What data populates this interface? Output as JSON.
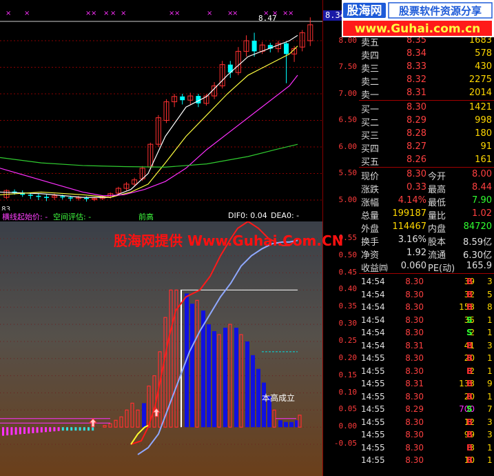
{
  "banner": {
    "logo_text": "股海网",
    "slogan": "股票软件资源分享",
    "url": "www.Guhai.com.cn"
  },
  "main_chart": {
    "price_tag": "8.34",
    "high_label": "8.47",
    "low_label": "83",
    "axis_labels": [
      "8.00",
      "7.50",
      "7.00",
      "6.50",
      "6.00",
      "5.50",
      "5.00"
    ]
  },
  "indicator": {
    "strip_items": [
      {
        "text": "横线起始价: -",
        "color": "#ff40ff"
      },
      {
        "text": "空间评估: -",
        "color": "#40ff40"
      },
      {
        "text": "前高",
        "color": "#40ff40"
      },
      {
        "text": "DIF0: 0.04",
        "color": "#ffffff"
      },
      {
        "text": "DEA0: -",
        "color": "#ffffff"
      }
    ],
    "watermark": "股海网提供 Www.Guhai.Com.CN",
    "annotation": "本高成立",
    "axis_labels": [
      "0.55",
      "0.50",
      "0.45",
      "0.40",
      "0.35",
      "0.30",
      "0.25",
      "0.20",
      "0.15",
      "0.10",
      "0.05",
      "0.00",
      "-0.05"
    ]
  },
  "order_book": {
    "asks": [
      {
        "label": "卖五",
        "price": "8.35",
        "volume": "1683"
      },
      {
        "label": "卖四",
        "price": "8.34",
        "volume": "578"
      },
      {
        "label": "卖三",
        "price": "8.33",
        "volume": "430"
      },
      {
        "label": "卖二",
        "price": "8.32",
        "volume": "2275"
      },
      {
        "label": "卖一",
        "price": "8.31",
        "volume": "2014"
      }
    ],
    "bids": [
      {
        "label": "买一",
        "price": "8.30",
        "volume": "1421"
      },
      {
        "label": "买二",
        "price": "8.29",
        "volume": "998"
      },
      {
        "label": "买三",
        "price": "8.28",
        "volume": "180"
      },
      {
        "label": "买四",
        "price": "8.27",
        "volume": "91"
      },
      {
        "label": "买五",
        "price": "8.26",
        "volume": "161"
      }
    ]
  },
  "stats": {
    "rows": [
      {
        "l1": "现价",
        "v1": "8.30",
        "l2": "今开",
        "v2": "8.00"
      },
      {
        "l1": "涨跌",
        "v1": "0.33",
        "l2": "最高",
        "v2": "8.44"
      },
      {
        "l1": "涨幅",
        "v1": "4.14%",
        "l2": "最低",
        "v2": "7.90"
      },
      {
        "l1": "总量",
        "v1": "199187",
        "l2": "量比",
        "v2": "1.02"
      },
      {
        "l1": "外盘",
        "v1": "114467",
        "l2": "内盘",
        "v2": "84720"
      },
      {
        "l1": "换手",
        "v1": "3.16%",
        "l2": "股本",
        "v2": "8.59亿"
      },
      {
        "l1": "净资",
        "v1": "1.92",
        "l2": "流通",
        "v2": "6.30亿"
      },
      {
        "l1": "收益㈣",
        "v1": "0.060",
        "l2": "PE(动)",
        "v2": "165.9"
      }
    ]
  },
  "ticks": [
    {
      "time": "14:54",
      "price": "8.30",
      "vol": "39",
      "bs": "B",
      "n": "3"
    },
    {
      "time": "14:54",
      "price": "8.30",
      "vol": "32",
      "bs": "B",
      "n": "5"
    },
    {
      "time": "14:54",
      "price": "8.30",
      "vol": "153",
      "bs": "B",
      "n": "8"
    },
    {
      "time": "14:54",
      "price": "8.30",
      "vol": "35",
      "bs": "S",
      "n": "1"
    },
    {
      "time": "14:54",
      "price": "8.30",
      "vol": "2",
      "bs": "S",
      "n": "1"
    },
    {
      "time": "14:54",
      "price": "8.31",
      "vol": "41",
      "bs": "B",
      "n": "3"
    },
    {
      "time": "14:55",
      "price": "8.30",
      "vol": "20",
      "bs": "B",
      "n": "1"
    },
    {
      "time": "14:55",
      "price": "8.30",
      "vol": "2",
      "bs": "B",
      "n": "1"
    },
    {
      "time": "14:55",
      "price": "8.31",
      "vol": "133",
      "bs": "B",
      "n": "9"
    },
    {
      "time": "14:55",
      "price": "8.30",
      "vol": "20",
      "bs": "B",
      "n": "1"
    },
    {
      "time": "14:55",
      "price": "8.29",
      "vol": "700",
      "bs": "S",
      "n": "7"
    },
    {
      "time": "14:55",
      "price": "8.30",
      "vol": "12",
      "bs": "B",
      "n": "3"
    },
    {
      "time": "14:55",
      "price": "8.30",
      "vol": "99",
      "bs": "B",
      "n": "3"
    },
    {
      "time": "14:55",
      "price": "8.30",
      "vol": "3",
      "bs": "B",
      "n": "1"
    },
    {
      "time": "14:55",
      "price": "8.30",
      "vol": "10",
      "bs": "B",
      "n": "1"
    }
  ],
  "colors": {
    "up": "#ff3030",
    "down": "#00ffff",
    "buy": "#ff3030",
    "sell": "#30ff30",
    "big_vol": "#ff30ff"
  }
}
